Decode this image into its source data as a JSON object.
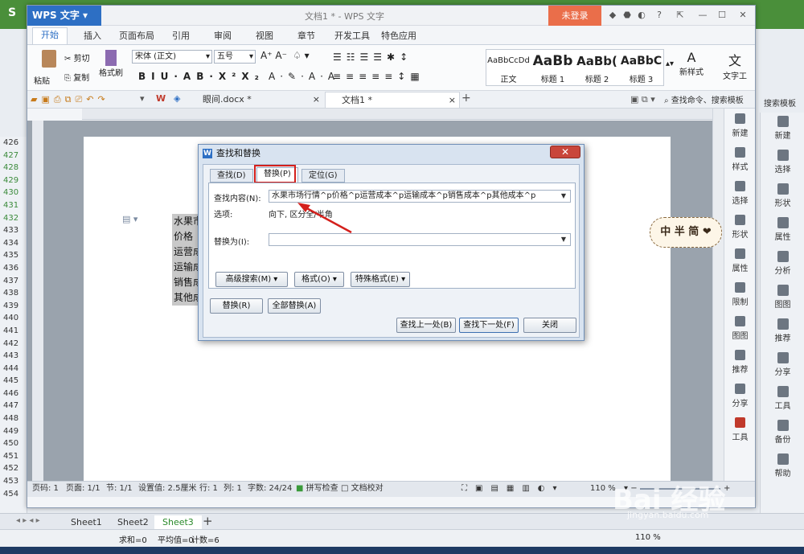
{
  "app": {
    "logo": "WPS 文字",
    "title": "文档1 * - WPS 文字",
    "login": "未登录"
  },
  "menu": [
    "开始",
    "插入",
    "页面布局",
    "引用",
    "审阅",
    "视图",
    "章节",
    "开发工具",
    "特色应用"
  ],
  "ribbon": {
    "paste": "粘贴",
    "cut": "剪切",
    "copy": "复制",
    "format_painter": "格式刷",
    "font": "宋体 (正文)",
    "size": "五号",
    "styles": [
      {
        "preview": "AaBbCcDd",
        "name": "正文"
      },
      {
        "preview": "AaBb",
        "name": "标题 1"
      },
      {
        "preview": "AaBb(",
        "name": "标题 2"
      },
      {
        "preview": "AaBbC",
        "name": "标题 3"
      }
    ],
    "new_style": "新样式",
    "text_tool": "文字工"
  },
  "tabs": [
    {
      "label": "眼间.docx *"
    },
    {
      "label": "文档1 *"
    }
  ],
  "search_placeholder": "查找命令、搜索模板",
  "doc_lines": [
    "水果市",
    "价格",
    "运营成",
    "运输成",
    "销售成",
    "其他成"
  ],
  "side": [
    "新建",
    "样式",
    "选择",
    "形状",
    "属性",
    "限制",
    "图图",
    "推荐",
    "分享",
    "工具"
  ],
  "status": {
    "page": "页码: 1",
    "pages": "页面: 1/1",
    "section": "节: 1/1",
    "setting": "设置值: 2.5厘米",
    "row": "行: 1",
    "col": "列: 1",
    "chars": "字数: 24/24",
    "spell": "拼写检查",
    "proof": "文档校对",
    "zoom": "110 %"
  },
  "dialog": {
    "title": "查找和替换",
    "tabs": [
      "查找(D)",
      "替换(P)",
      "定位(G)"
    ],
    "find_label": "查找内容(N):",
    "find_value": "水果市场行情^p价格^p运营成本^p运输成本^p销售成本^p其他成本^p",
    "options_label": "选项:",
    "options_value": "向下, 区分全/半角",
    "replace_label": "替换为(I):",
    "replace_value": "",
    "advanced": "高级搜索(M) ▾",
    "format": "格式(O) ▾",
    "special": "特殊格式(E) ▾",
    "replace": "替换(R)",
    "replace_all": "全部替换(A)",
    "find_prev": "查找上一处(B)",
    "find_next": "查找下一处(F)",
    "close": "关闭"
  },
  "excel": {
    "rows": [
      "426",
      "427",
      "428",
      "429",
      "430",
      "431",
      "432",
      "433",
      "434",
      "435",
      "436",
      "437",
      "438",
      "439",
      "440",
      "441",
      "442",
      "443",
      "444",
      "445",
      "446",
      "447",
      "448",
      "449",
      "450",
      "451",
      "452",
      "453",
      "454"
    ],
    "sheets": [
      "Sheet1",
      "Sheet2",
      "Sheet3"
    ],
    "sum": "求和=0",
    "avg": "平均值=0",
    "count": "计数=6",
    "zoom": "110 %",
    "panel": [
      "新建",
      "选择",
      "形状",
      "属性",
      "分析",
      "图图",
      "推荐",
      "分享",
      "工具",
      "备份",
      "帮助"
    ],
    "search": "搜索模板"
  },
  "stamp": "中 半 简 ❤",
  "watermark": {
    "main": "Bai 经验",
    "sub": "jingyan.baidu.com"
  }
}
